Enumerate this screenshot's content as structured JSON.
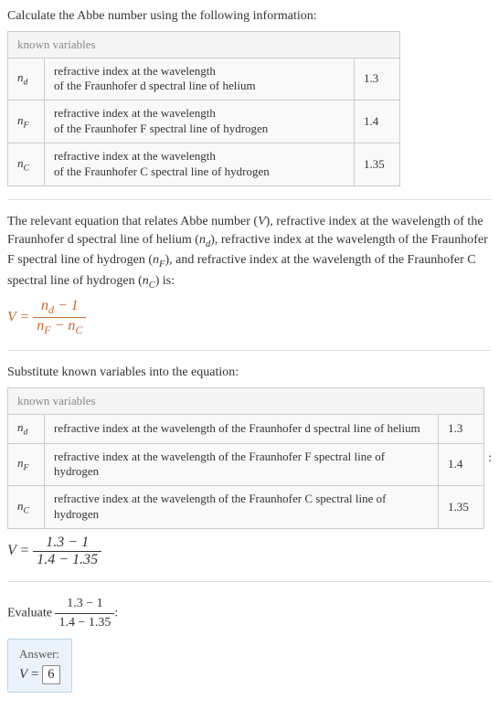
{
  "intro": "Calculate the Abbe number using the following information:",
  "vars_header": "known variables",
  "variables": [
    {
      "sym": "n",
      "sub": "d",
      "desc": "refractive index at the wavelength of the Fraunhofer d spectral line of helium",
      "desc_2line": "refractive index at the wavelength\nof the Fraunhofer d spectral line of helium",
      "val": "1.3"
    },
    {
      "sym": "n",
      "sub": "F",
      "desc": "refractive index at the wavelength of the Fraunhofer F spectral line of hydrogen",
      "desc_2line": "refractive index at the wavelength\nof the Fraunhofer F spectral line of hydrogen",
      "val": "1.4"
    },
    {
      "sym": "n",
      "sub": "C",
      "desc": "refractive index at the wavelength of the Fraunhofer C spectral line of hydrogen",
      "desc_2line": "refractive index at the wavelength\nof the Fraunhofer C spectral line of hydrogen",
      "val": "1.35"
    }
  ],
  "relevant_text": {
    "p1": "The relevant equation that relates Abbe number ",
    "V": "V",
    "p2": "), refractive index at the wavelength of the Fraunhofer d spectral line of helium (",
    "nd": "n",
    "nd_sub": "d",
    "p3": "), refractive index at the wavelength of the Fraunhofer F spectral line of hydrogen (",
    "nF": "n",
    "nF_sub": "F",
    "p4": "), and refractive index at the wavelength of the Fraunhofer C spectral line of hydrogen (",
    "nC": "n",
    "nC_sub": "C",
    "p5": ") is:"
  },
  "equation1": {
    "lhs": "V",
    "eq": " = ",
    "num_a": "n",
    "num_a_sub": "d",
    "num_b": " − 1",
    "den_a": "n",
    "den_a_sub": "F",
    "den_mid": " − ",
    "den_b": "n",
    "den_b_sub": "C"
  },
  "substitute_text": "Substitute known variables into the equation:",
  "equation2": {
    "lhs": "V",
    "eq": " = ",
    "num": "1.3 − 1",
    "den": "1.4 − 1.35"
  },
  "evaluate": {
    "pre": "Evaluate ",
    "num": "1.3 − 1",
    "den": "1.4 − 1.35",
    "post": ":"
  },
  "answer": {
    "label": "Answer:",
    "var": "V",
    "eq": " = ",
    "val": "6"
  },
  "chart_data": {
    "type": "table",
    "title": "known variables",
    "rows": [
      {
        "symbol": "n_d",
        "description": "refractive index at the wavelength of the Fraunhofer d spectral line of helium",
        "value": 1.3
      },
      {
        "symbol": "n_F",
        "description": "refractive index at the wavelength of the Fraunhofer F spectral line of hydrogen",
        "value": 1.4
      },
      {
        "symbol": "n_C",
        "description": "refractive index at the wavelength of the Fraunhofer C spectral line of hydrogen",
        "value": 1.35
      }
    ],
    "equation": "V = (n_d - 1) / (n_F - n_C)",
    "substituted": "V = (1.3 - 1) / (1.4 - 1.35)",
    "result": 6
  }
}
